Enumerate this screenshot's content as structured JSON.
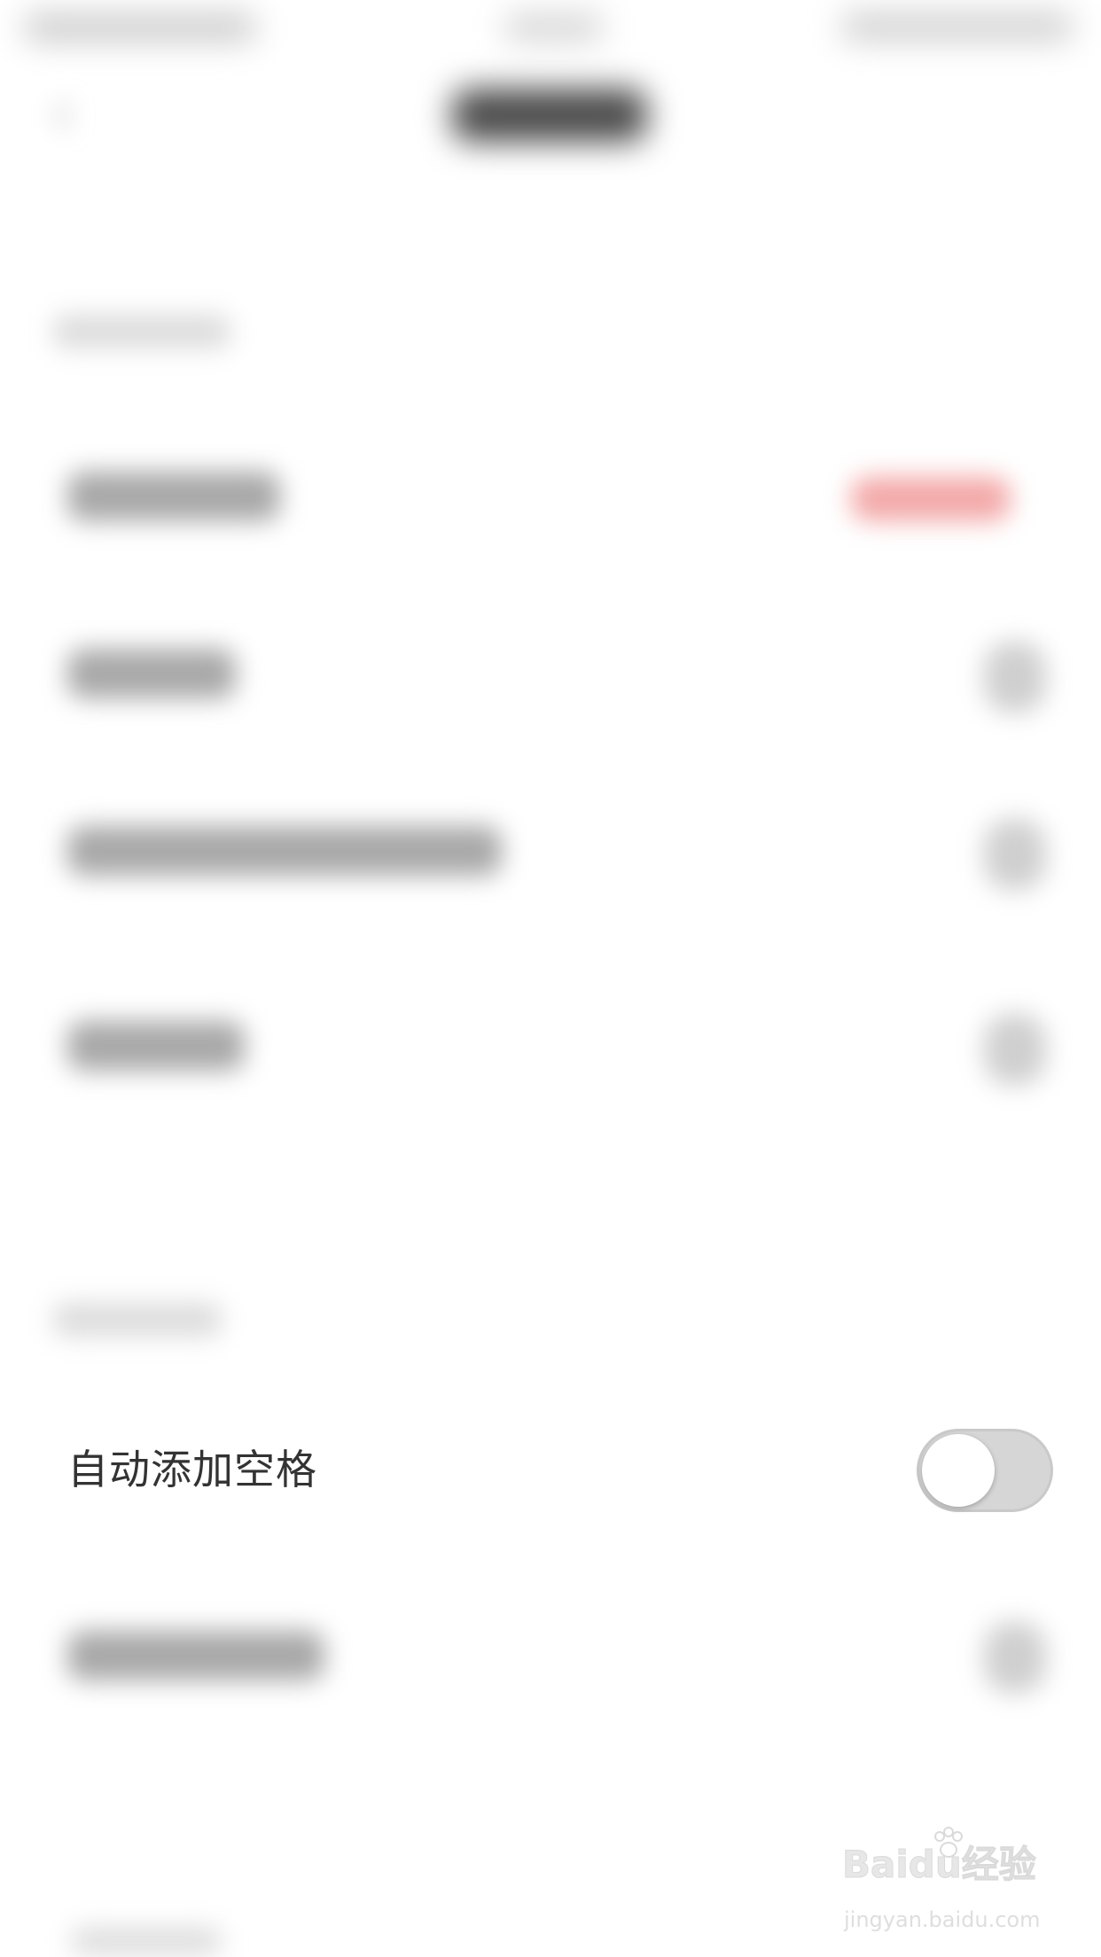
{
  "settings": {
    "auto_space_label": "自动添加空格",
    "auto_space_enabled": false
  },
  "watermark": {
    "logo_text": "Baidu经验",
    "url_text": "jingyan.baidu.com"
  },
  "colors": {
    "background": "#ffffff",
    "text": "#333333",
    "toggle_off_track": "#d6d6d6",
    "toggle_knob": "#ffffff"
  },
  "icons": {
    "back": "chevron-left-icon"
  }
}
